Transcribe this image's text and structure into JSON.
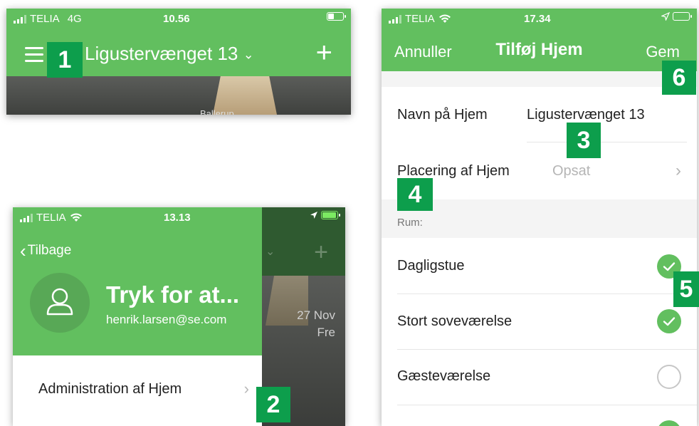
{
  "screen1": {
    "status": {
      "carrier": "TELIA",
      "network": "4G",
      "time": "10.56"
    },
    "title": "Ligustervænget 13",
    "photo_text": "Ballerup"
  },
  "screen2": {
    "status": {
      "carrier": "TELIA",
      "time": "13.13"
    },
    "back_label": "Tilbage",
    "user_name": "Tryk for at...",
    "user_email": "henrik.larsen@se.com",
    "menu_item": "Administration af Hjem",
    "date_line1": "27 Nov",
    "date_line2": "Fre"
  },
  "screen3": {
    "status": {
      "carrier": "TELIA",
      "time": "17.34"
    },
    "cancel": "Annuller",
    "title": "Tilføj Hjem",
    "save": "Gem",
    "home_name_label": "Navn på Hjem",
    "home_name_value": "Ligustervænget 13",
    "location_label": "Placering af Hjem",
    "location_value": "Opsat",
    "rooms_label": "Rum:",
    "rooms": [
      {
        "name": "Dagligstue",
        "checked": true
      },
      {
        "name": "Stort soveværelse",
        "checked": true
      },
      {
        "name": "Gæsteværelse",
        "checked": false
      }
    ]
  },
  "badges": [
    "1",
    "2",
    "3",
    "4",
    "5",
    "6"
  ],
  "colors": {
    "brand_green": "#62bf5f",
    "badge_green": "#0d9e4c"
  }
}
